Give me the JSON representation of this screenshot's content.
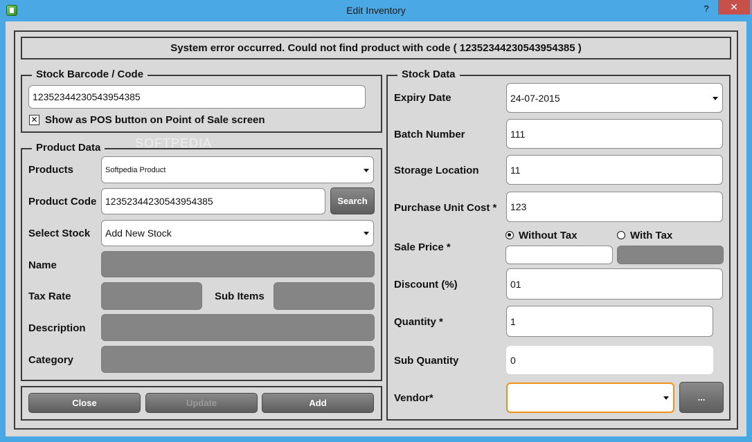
{
  "window": {
    "title": "Edit Inventory",
    "help_label": "?",
    "close_label": "✕"
  },
  "error_message": "System error occurred. Could not find product with code ( 12352344230543954385 )",
  "barcode_group": {
    "legend": "Stock Barcode / Code",
    "value": "12352344230543954385",
    "pos_checkbox_label": "Show as POS button on Point of Sale screen",
    "pos_checkbox_mark": "✕"
  },
  "product_data": {
    "legend": "Product Data",
    "products_label": "Products",
    "products_value": "Softpedia Product",
    "product_code_label": "Product Code",
    "product_code_value": "12352344230543954385",
    "search_label": "Search",
    "select_stock_label": "Select Stock",
    "select_stock_value": "Add New Stock",
    "name_label": "Name",
    "tax_rate_label": "Tax Rate",
    "sub_items_label": "Sub Items",
    "description_label": "Description",
    "category_label": "Category"
  },
  "actions": {
    "close_label": "Close",
    "update_label": "Update",
    "add_label": "Add"
  },
  "stock_data": {
    "legend": "Stock Data",
    "expiry_label": "Expiry Date",
    "expiry_value": "24-07-2015",
    "batch_label": "Batch Number",
    "batch_value": "111",
    "storage_label": "Storage Location",
    "storage_value": "11",
    "purchase_label": "Purchase Unit Cost *",
    "purchase_value": "123",
    "sale_label": "Sale Price *",
    "without_tax_label": "Without Tax",
    "with_tax_label": "With Tax",
    "discount_label": "Discount (%)",
    "discount_value": "01",
    "quantity_label": "Quantity *",
    "quantity_value": "1",
    "sub_quantity_label": "Sub Quantity",
    "sub_quantity_value": "0",
    "vendor_label": "Vendor*",
    "vendor_value": "",
    "vendor_more_label": "..."
  },
  "watermark": "SOFTPEDIA",
  "colors": {
    "titlebar": "#4aa9e4",
    "close_button": "#c7504b",
    "panel_bg": "#d9d9d9",
    "disabled_field": "#858585",
    "focus_border": "#f0911a"
  }
}
